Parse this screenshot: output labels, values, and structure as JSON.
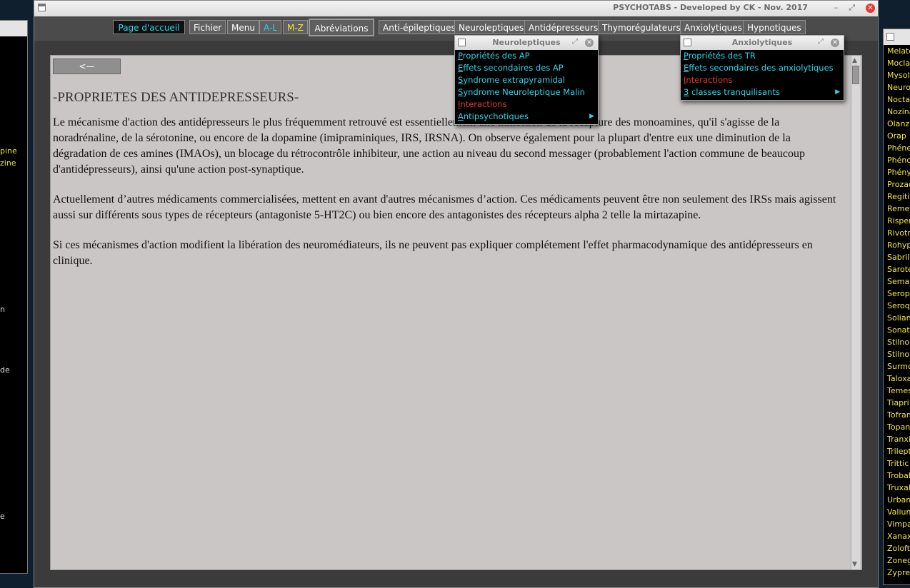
{
  "left_window": {
    "items": [
      "pine",
      "zine",
      "n",
      "de",
      "e"
    ]
  },
  "right_window": {
    "items": [
      "Melato",
      "Moclar",
      "Mysoli",
      "Neuro",
      "Nocta",
      "Nozina",
      "Olanza",
      "Orap",
      "Phéne",
      "Phéno",
      "Phény",
      "Prozac",
      "Regiti",
      "Remer",
      "Risper",
      "Rivotr",
      "Rohyp",
      "Sabril",
      "Sarote",
      "Semap",
      "Serop",
      "Seroq",
      "Solian",
      "Sonat",
      "Stilno",
      "Stilno",
      "Surmo",
      "Taloxa",
      "Temes",
      "Tiapri",
      "Tofran",
      "Topan",
      "Tranxi",
      "Trilept",
      "Trittic",
      "Trobal",
      "Truxal",
      "Urban",
      "Valium",
      "Vimpa",
      "Xanax",
      "Zoloft",
      "Zoneg",
      "Zypre"
    ]
  },
  "window": {
    "title": "PSYCHOTABS - Developed by CK - Nov. 2017",
    "minimize": "–",
    "maximize": "⤢",
    "close": "✕"
  },
  "toolbar": {
    "home": "Page d'accueil",
    "file": "Fichier",
    "menu": "Menu",
    "al": "A-L",
    "mz": "M-Z",
    "abbreviations": "Abréviations",
    "antiepileptics": "Anti-épileptiques",
    "neuroleptics": "Neuroleptiques",
    "antidepressants": "Antidépresseurs",
    "mood_stabilizers": "Thymorégulateurs",
    "anxiolytics": "Anxiolytiques",
    "hypnotics": "Hypnotiques"
  },
  "content": {
    "back_button": "<—",
    "title": "-PROPRIETES DES ANTIDEPRESSEURS-",
    "paragraph1": "Le mécanisme d'action des antidépresseurs le plus fréquemment retrouvé est essentiellement une inhibition de la recapture des monoamines, qu'il s'agisse de la noradrénaline, de la sérotonine, ou encore de la dopamine (imipraminiques, IRS, IRSNA). On observe également pour la plupart d'entre eux une diminution de la dégradation de ces amines (IMAOs), un blocage du rétrocontrôle inhibiteur, une action au niveau du second messager (probablement l'action commune de beaucoup d'antidépresseurs), ainsi qu'une action post-synaptique.",
    "paragraph2": "Actuellement d’autres médicaments commercialisées, mettent en avant d'autres mécanismes d’action. Ces médicaments peuvent être non seulement des IRSs mais agissent aussi sur différents sous types de récepteurs (antagoniste 5-HT2C) ou bien encore des antagonistes des récepteurs alpha 2 telle la mirtazapine.",
    "paragraph3": "Si ces mécanismes d'action modifient la libération des neuromédiateurs, ils ne peuvent pas expliquer complétement l'effet pharmacodynamique des antidépresseurs en clinique."
  },
  "neuroleptics_popup": {
    "title": "Neuroleptiques",
    "items": [
      {
        "acc": "P",
        "rest": "ropriétés des AP",
        "color": "cyan"
      },
      {
        "acc": "E",
        "rest": "ffets secondaires des AP",
        "color": "cyan"
      },
      {
        "acc": "S",
        "rest": "yndrome extrapyramidal",
        "color": "cyan"
      },
      {
        "acc": "S",
        "rest": "yndrome Neuroleptique Malin",
        "color": "cyan"
      },
      {
        "acc": "I",
        "rest": "nteractions",
        "color": "red"
      },
      {
        "acc": "A",
        "rest": "ntipsychotiques",
        "color": "cyan",
        "submenu": true
      }
    ]
  },
  "anxiolytics_popup": {
    "title": "Anxiolytiques",
    "items": [
      {
        "acc": "P",
        "rest": "ropriétés des TR",
        "color": "cyan"
      },
      {
        "acc": "E",
        "rest": "ffets secondaires des anxiolytiques",
        "color": "cyan"
      },
      {
        "acc": "I",
        "rest": "nteractions",
        "color": "red"
      },
      {
        "acc": "3",
        "rest": " classes tranquilisants",
        "color": "cyan",
        "submenu": true
      }
    ]
  },
  "colors": {
    "accent_cyan": "#2ed3e9",
    "accent_yellow": "#f1e63b",
    "accent_red": "#e53935",
    "content_bg": "#cbc6c6"
  }
}
